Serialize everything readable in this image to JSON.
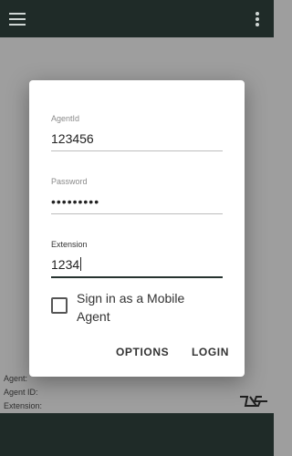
{
  "topbar": {
    "menu_icon": "hamburger-menu-icon",
    "more_icon": "more-vert-icon"
  },
  "login_dialog": {
    "agent_id": {
      "label": "AgentId",
      "value": "123456"
    },
    "password": {
      "label": "Password",
      "value": "•••••••••"
    },
    "extension": {
      "label": "Extension",
      "value": "1234"
    },
    "mobile_agent": {
      "label": "Sign in as a Mobile Agent",
      "checked": false
    },
    "buttons": {
      "options": "OPTIONS",
      "login": "LOGIN"
    }
  },
  "status_info": {
    "agent_label": "Agent:",
    "agent_id_label": "Agent ID:",
    "extension_label": "Extension:"
  },
  "logo": {
    "icon": "brand-logo-icon"
  },
  "colors": {
    "bar": "#1f2b28",
    "overlay": "#9e9e9e",
    "dialog": "#ffffff",
    "focus_underline": "#26332f"
  }
}
